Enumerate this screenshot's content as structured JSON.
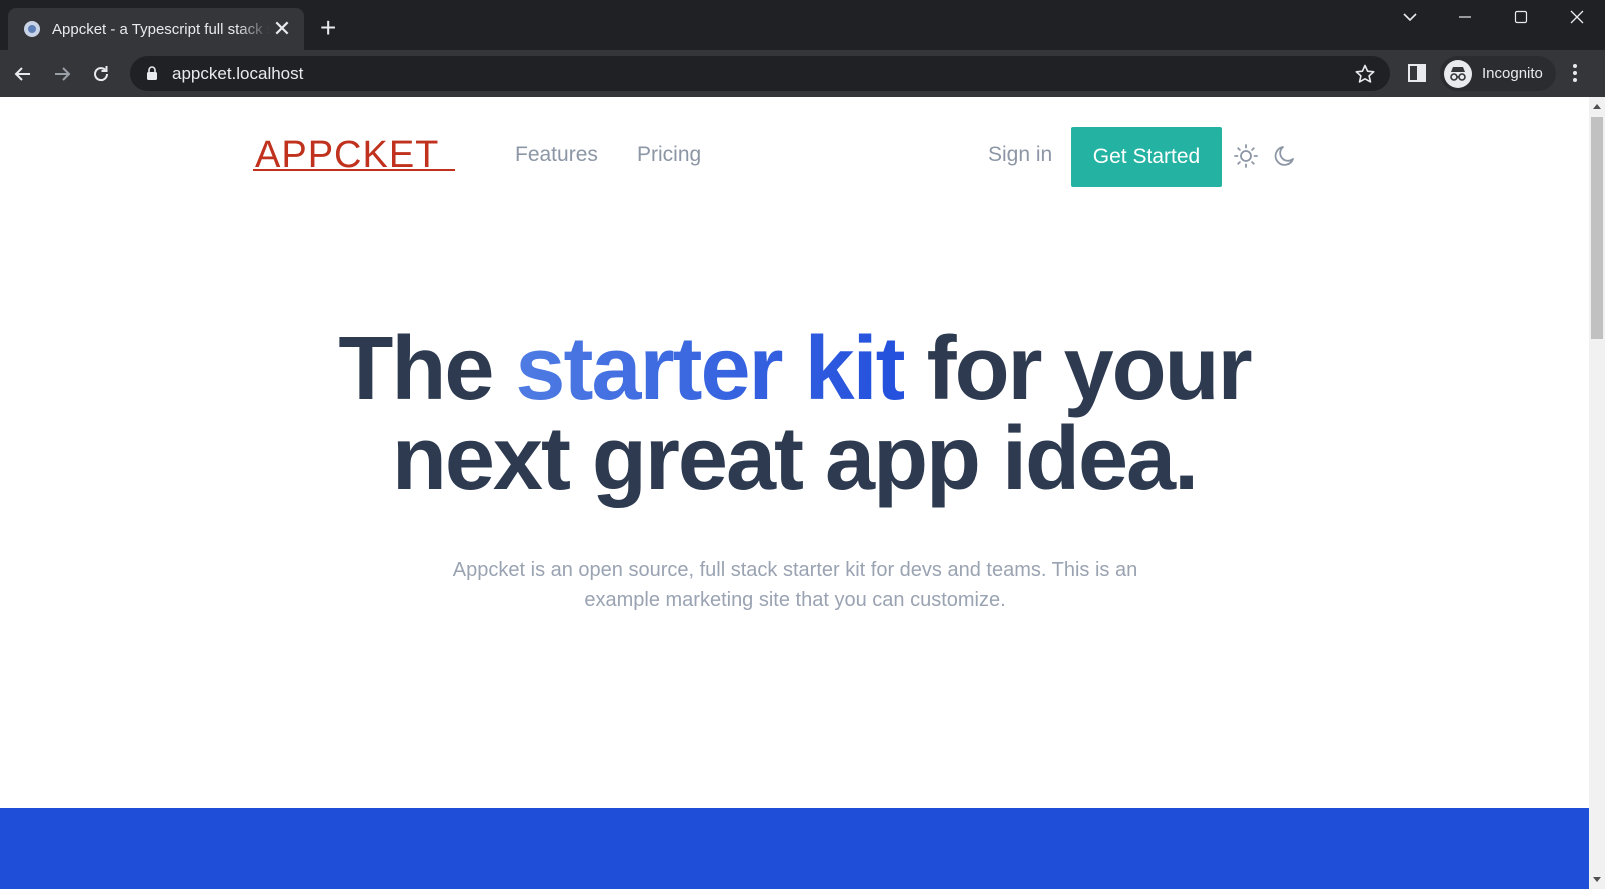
{
  "browser": {
    "tab_title": "Appcket - a Typescript full stack starter",
    "tab_close": "✕",
    "new_tab": "+",
    "url": "appcket.localhost",
    "profile_label": "Incognito"
  },
  "site": {
    "logo": "APPCKET",
    "nav": [
      {
        "label": "Features"
      },
      {
        "label": "Pricing"
      }
    ],
    "signin": "Sign in",
    "cta": "Get Started"
  },
  "hero": {
    "line1_pre": "The ",
    "line1_accent": "starter kit",
    "line1_post": " for your",
    "line2": "next great app idea.",
    "subtitle": "Appcket is an open source, full stack starter kit for devs and teams. This is an example marketing site that you can customize."
  },
  "colors": {
    "brand_red": "#c0321e",
    "cta_teal": "#24b2a2",
    "accent_blue": "#2350dd",
    "band_blue": "#1f4ed8",
    "heading": "#2d3a50"
  },
  "icons": [
    "back-icon",
    "forward-icon",
    "reload-icon",
    "lock-icon",
    "star-icon",
    "side-panel-icon",
    "incognito-icon",
    "menu-kebab-icon",
    "sun-icon",
    "moon-icon"
  ]
}
